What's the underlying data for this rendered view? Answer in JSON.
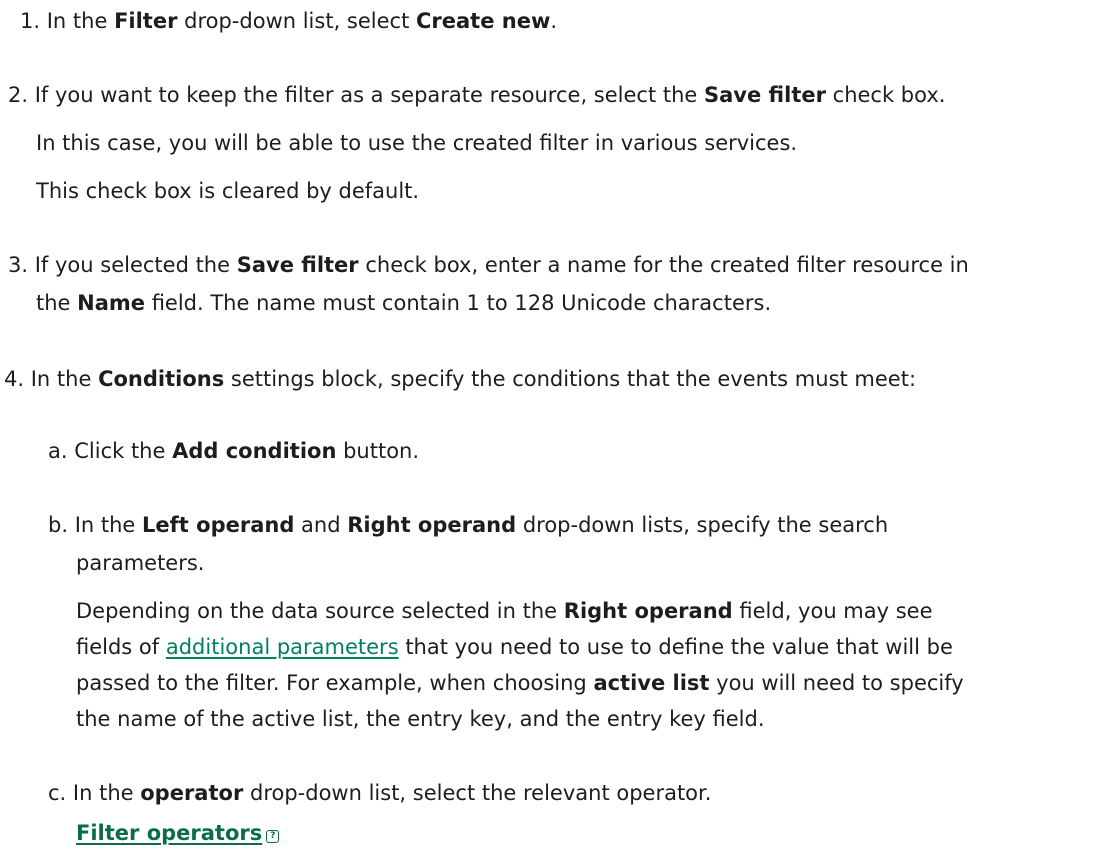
{
  "steps": [
    {
      "num": "1.",
      "text1": "In the ",
      "b1": "Filter",
      "text2": " drop-down list, select ",
      "b2": "Create new",
      "text3": "."
    },
    {
      "num": "2.",
      "text1": "If you want to keep the filter as a separate resource, select the ",
      "b1": "Save filter",
      "text2": " check box.",
      "sub1": "In this case, you will be able to use the created filter in various services.",
      "sub2": "This check box is cleared by default."
    },
    {
      "num": "3.",
      "text1": "If you selected the ",
      "b1": "Save filter",
      "text2": " check box, enter a name for the created filter resource in",
      "line2_pre": "the ",
      "b2": "Name",
      "line2_post": " field. The name must contain 1 to 128 Unicode characters."
    },
    {
      "num": "4.",
      "text1": "In the ",
      "b1": "Conditions",
      "text2": " settings block, specify the conditions that the events must meet:"
    }
  ],
  "substeps": [
    {
      "letter": "a.",
      "text1": "Click the ",
      "b1": "Add condition",
      "text2": " button."
    },
    {
      "letter": "b.",
      "text1": "In the ",
      "b1": "Left operand",
      "text2": " and ",
      "b2": "Right operand",
      "text3": " drop-down lists, specify the search",
      "line2": "parameters.",
      "p_line1_pre": "Depending on the data source selected in the ",
      "p_b1": "Right operand",
      "p_line1_post": " field, you may see",
      "p_line2_pre": "fields of ",
      "p_link": "additional parameters",
      "p_line2_post": " that you need to use to define the value that will be",
      "p_line3_pre": "passed to the filter. For example, when choosing ",
      "p_b2": "active list",
      "p_line3_post": " you will need to specify",
      "p_line4": "the name of the active list, the entry key, and the entry key field."
    },
    {
      "letter": "c.",
      "text1": "In the ",
      "b1": "operator",
      "text2": " drop-down list, select the relevant operator.",
      "link": "Filter operators",
      "link_icon": "?"
    }
  ]
}
